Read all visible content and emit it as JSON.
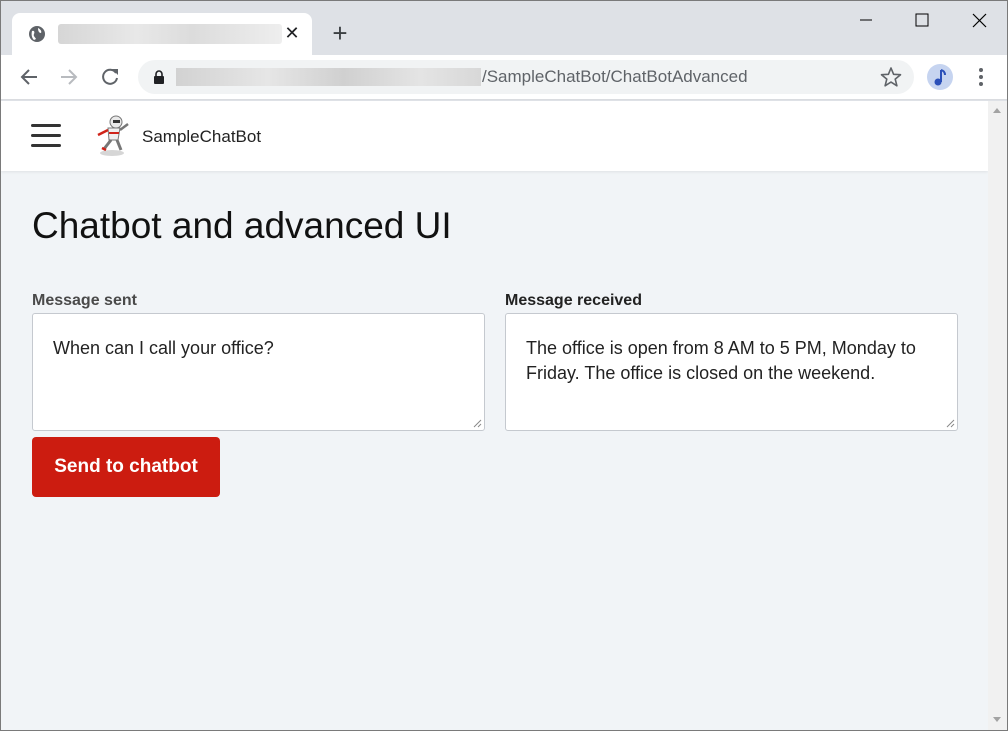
{
  "browser": {
    "tab": {
      "close_glyph": "✕",
      "icon": "globe-icon"
    },
    "new_tab_glyph": "+",
    "address": {
      "url_visible": "/SampleChatBot/ChatBotAdvanced"
    },
    "icons": [
      "back-icon",
      "forward-icon",
      "reload-icon",
      "lock-icon",
      "star-icon",
      "profile-icon",
      "more-icon"
    ]
  },
  "navbar": {
    "brand": "SampleChatBot"
  },
  "page": {
    "title": "Chatbot and advanced UI",
    "sent": {
      "label": "Message sent",
      "value": "When can I call your office?"
    },
    "received": {
      "label": "Message received",
      "value": "The office is open from 8 AM to 5 PM, Monday to Friday. The office is closed on the weekend."
    },
    "send_button": "Send to chatbot"
  },
  "colors": {
    "accent": "#cc1c10",
    "page_background": "#f1f4f7"
  }
}
